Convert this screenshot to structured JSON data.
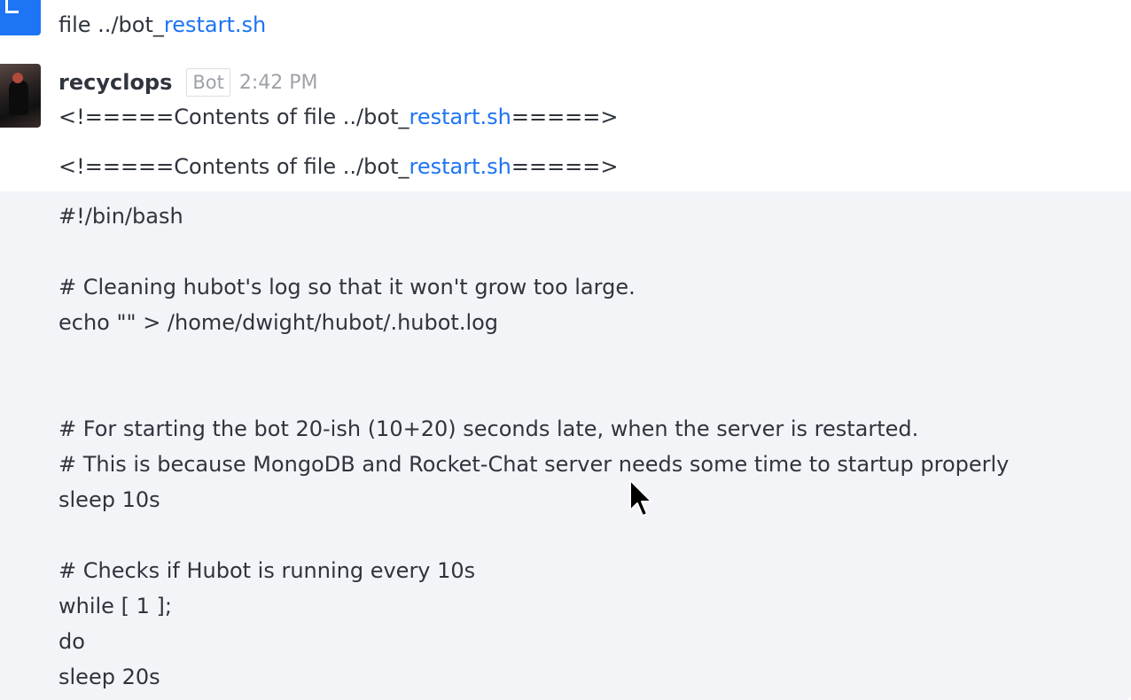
{
  "previous_message": {
    "prefix": "file ../bot_",
    "link": "restart.sh"
  },
  "message": {
    "username": "recyclops",
    "tag": "Bot",
    "time": "2:42 PM",
    "header_line": {
      "prefix": "<!=====Contents of file ../bot_",
      "link": "restart.sh",
      "suffix": "=====>"
    },
    "body_line": {
      "prefix": "<!=====Contents of file ../bot_",
      "link": "restart.sh",
      "suffix": "=====>"
    },
    "code_lines": [
      "#!/bin/bash",
      "",
      "# Cleaning hubot's log so that it won't grow too large.",
      "echo \"\" > /home/dwight/hubot/.hubot.log",
      "",
      "",
      "# For starting the bot 20-ish (10+20) seconds late, when the server is restarted.",
      "# This is because MongoDB and Rocket-Chat server needs some time to startup properly",
      "sleep 10s",
      "",
      "# Checks if Hubot is running every 10s",
      "while [ 1 ];",
      "do",
      "sleep 20s"
    ]
  },
  "colors": {
    "link": "#1d74f5",
    "code_background": "#f3f4f8",
    "text": "#2f343d",
    "muted": "#9ea2a8"
  },
  "icons": {
    "previous_avatar": "user-avatar-icon",
    "bot_avatar": "bot-avatar",
    "cursor": "mouse-pointer-icon"
  }
}
